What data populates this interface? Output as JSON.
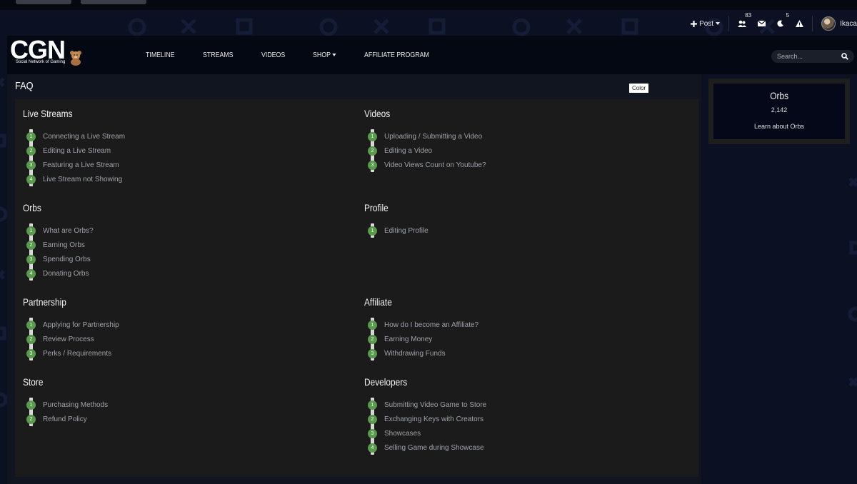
{
  "header": {
    "logo_text": "CGN",
    "logo_tagline": "Social Network of Gaming",
    "nav": [
      {
        "label": "TIMELINE"
      },
      {
        "label": "STREAMS"
      },
      {
        "label": "VIDEOS"
      },
      {
        "label": "SHOP"
      },
      {
        "label": "AFFILIATE PROGRAM"
      }
    ],
    "search_placeholder": "Search..."
  },
  "util": {
    "post_label": "Post",
    "notifications_count": "83",
    "messages_icon": "envelope-icon",
    "moon_count": "5",
    "alert_icon": "warning-icon",
    "username": "Ikaca"
  },
  "main": {
    "title": "FAQ",
    "color_chip": "Color",
    "sections": [
      {
        "heading": "Live Streams",
        "items": [
          "Connecting a Live Stream",
          "Editing a Live Stream",
          "Featuring a Live Stream",
          "Live Stream not Showing"
        ]
      },
      {
        "heading": "Videos",
        "items": [
          "Uploading / Submitting a Video",
          "Editing a Video",
          "Video Views Count on Youtube?"
        ]
      },
      {
        "heading": "Orbs",
        "items": [
          "What are Orbs?",
          "Earning Orbs",
          "Spending Orbs",
          "Donating Orbs"
        ]
      },
      {
        "heading": "Profile",
        "items": [
          "Editing Profile"
        ]
      },
      {
        "heading": "Partnership",
        "items": [
          "Applying for Partnership",
          "Review Process",
          "Perks / Requirements"
        ]
      },
      {
        "heading": "Affiliate",
        "items": [
          "How do I become an Affiliate?",
          "Earning Money",
          "Withdrawing Funds"
        ]
      },
      {
        "heading": "Store",
        "items": [
          "Purchasing Methods",
          "Refund Policy"
        ]
      },
      {
        "heading": "Developers",
        "items": [
          "Submitting Video Game to Store",
          "Exchanging Keys with Creators",
          "Showcases",
          "Selling Game during Showcase"
        ]
      }
    ]
  },
  "orbs": {
    "title": "Orbs",
    "count": "2,142",
    "link": "Learn about Orbs"
  },
  "colors": {
    "accent_green": "#5a9a4c",
    "bg": "#0b1022",
    "panel": "#1b1b1b"
  }
}
